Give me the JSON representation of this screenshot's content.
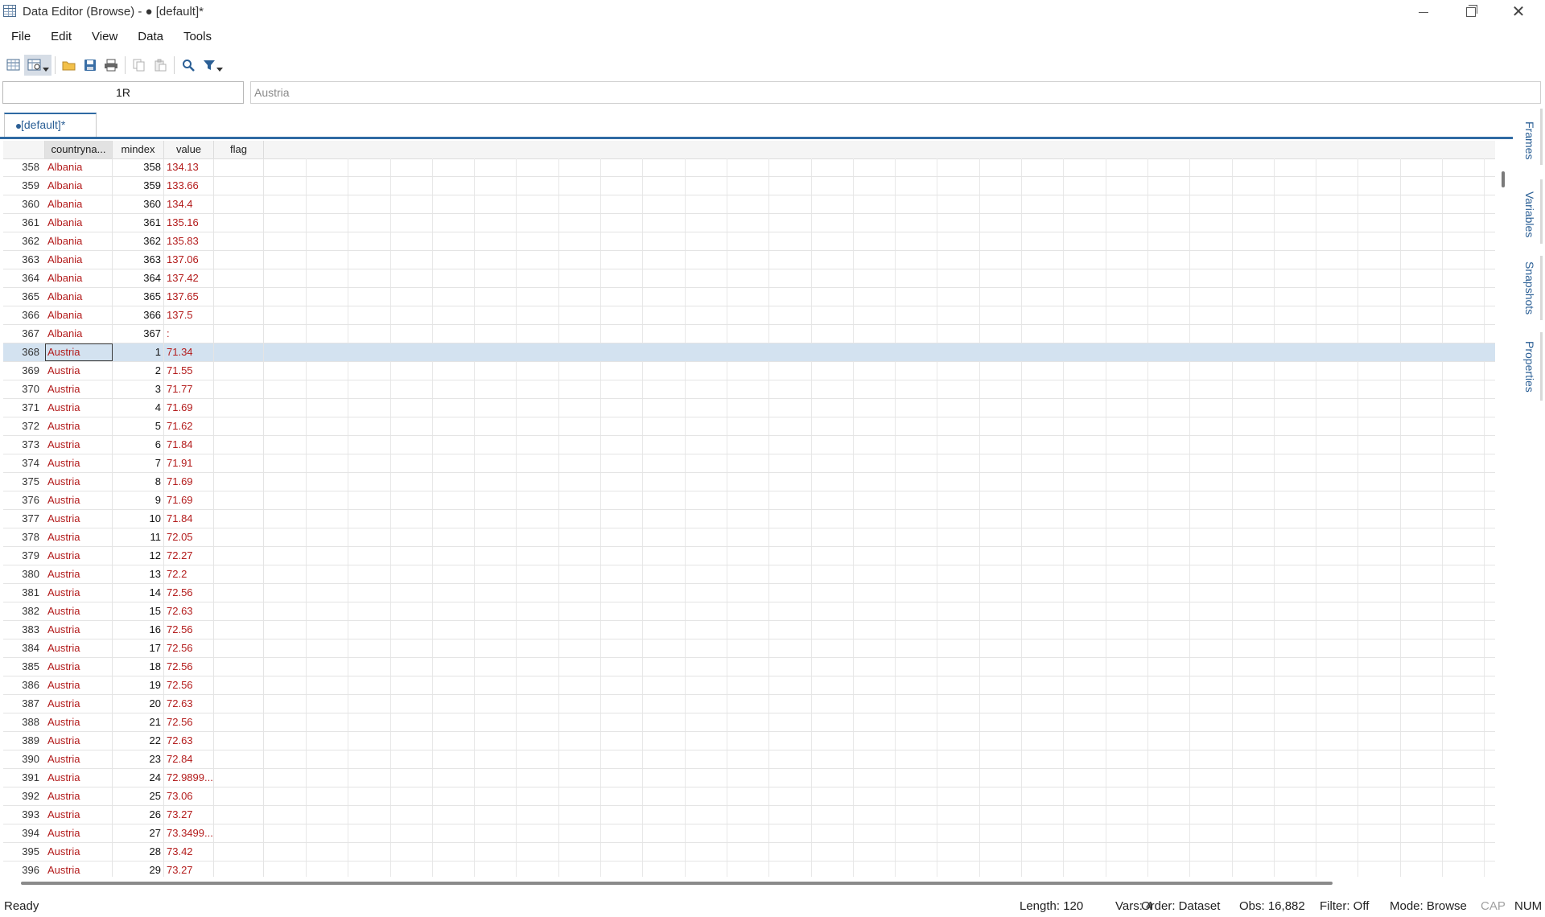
{
  "window": {
    "title": "Data Editor (Browse) - ● [default]*"
  },
  "menu": [
    "File",
    "Edit",
    "View",
    "Data",
    "Tools"
  ],
  "refbar": {
    "cell_ref": "1R",
    "cell_value": "Austria"
  },
  "tab": {
    "label": "[default]*"
  },
  "columns": [
    "countryna...",
    "mindex",
    "value",
    "flag"
  ],
  "rows": [
    [
      "358",
      "Albania",
      "358",
      "134.13"
    ],
    [
      "359",
      "Albania",
      "359",
      "133.66"
    ],
    [
      "360",
      "Albania",
      "360",
      "134.4"
    ],
    [
      "361",
      "Albania",
      "361",
      "135.16"
    ],
    [
      "362",
      "Albania",
      "362",
      "135.83"
    ],
    [
      "363",
      "Albania",
      "363",
      "137.06"
    ],
    [
      "364",
      "Albania",
      "364",
      "137.42"
    ],
    [
      "365",
      "Albania",
      "365",
      "137.65"
    ],
    [
      "366",
      "Albania",
      "366",
      "137.5"
    ],
    [
      "367",
      "Albania",
      "367",
      ":"
    ],
    [
      "368",
      "Austria",
      "1",
      "71.34"
    ],
    [
      "369",
      "Austria",
      "2",
      "71.55"
    ],
    [
      "370",
      "Austria",
      "3",
      "71.77"
    ],
    [
      "371",
      "Austria",
      "4",
      "71.69"
    ],
    [
      "372",
      "Austria",
      "5",
      "71.62"
    ],
    [
      "373",
      "Austria",
      "6",
      "71.84"
    ],
    [
      "374",
      "Austria",
      "7",
      "71.91"
    ],
    [
      "375",
      "Austria",
      "8",
      "71.69"
    ],
    [
      "376",
      "Austria",
      "9",
      "71.69"
    ],
    [
      "377",
      "Austria",
      "10",
      "71.84"
    ],
    [
      "378",
      "Austria",
      "11",
      "72.05"
    ],
    [
      "379",
      "Austria",
      "12",
      "72.27"
    ],
    [
      "380",
      "Austria",
      "13",
      "72.2"
    ],
    [
      "381",
      "Austria",
      "14",
      "72.56"
    ],
    [
      "382",
      "Austria",
      "15",
      "72.63"
    ],
    [
      "383",
      "Austria",
      "16",
      "72.56"
    ],
    [
      "384",
      "Austria",
      "17",
      "72.56"
    ],
    [
      "385",
      "Austria",
      "18",
      "72.56"
    ],
    [
      "386",
      "Austria",
      "19",
      "72.56"
    ],
    [
      "387",
      "Austria",
      "20",
      "72.63"
    ],
    [
      "388",
      "Austria",
      "21",
      "72.56"
    ],
    [
      "389",
      "Austria",
      "22",
      "72.63"
    ],
    [
      "390",
      "Austria",
      "23",
      "72.84"
    ],
    [
      "391",
      "Austria",
      "24",
      "72.9899..."
    ],
    [
      "392",
      "Austria",
      "25",
      "73.06"
    ],
    [
      "393",
      "Austria",
      "26",
      "73.27"
    ],
    [
      "394",
      "Austria",
      "27",
      "73.3499..."
    ],
    [
      "395",
      "Austria",
      "28",
      "73.42"
    ],
    [
      "396",
      "Austria",
      "29",
      "73.27"
    ]
  ],
  "selected_row": "368",
  "side_panels": [
    "Frames",
    "Variables",
    "Snapshots",
    "Properties"
  ],
  "status": {
    "ready": "Ready",
    "length": "Length: 120",
    "vars": "Vars: 4",
    "order": "Order: Dataset",
    "obs": "Obs: 16,882",
    "filter": "Filter: Off",
    "mode": "Mode: Browse",
    "cap": "CAP",
    "num": "NUM"
  },
  "colors": {
    "accent": "#2f6aa3",
    "string_text": "#b31b1b",
    "selected_row": "#d3e2f0"
  }
}
